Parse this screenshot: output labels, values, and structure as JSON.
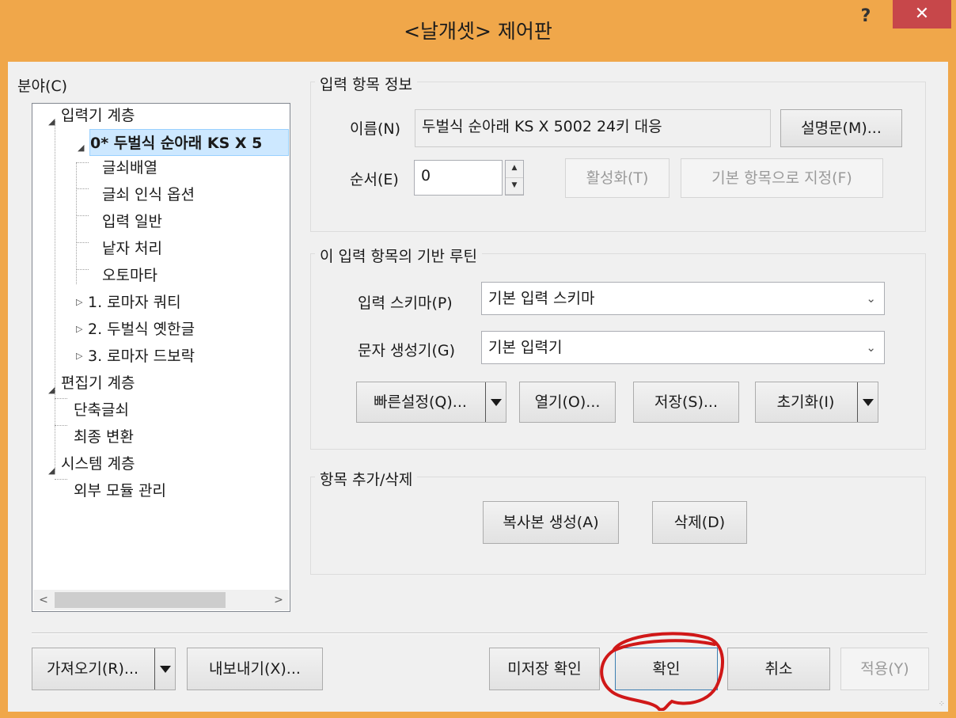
{
  "window": {
    "title": "<날개셋> 제어판",
    "help": "?",
    "close": "✕"
  },
  "colors": {
    "titlebar": "#f0a74a",
    "close": "#c7474a",
    "selection": "#cde8ff",
    "annotation": "#d01818"
  },
  "left": {
    "section_label": "분야(C)",
    "tree": [
      {
        "label": "입력기 계층",
        "level": 0,
        "expanded": true
      },
      {
        "label": "0* 두벌식 순아래 KS X 5",
        "level": 1,
        "expanded": true,
        "selected": true
      },
      {
        "label": "글쇠배열",
        "level": 2
      },
      {
        "label": "글쇠 인식 옵션",
        "level": 2
      },
      {
        "label": "입력 일반",
        "level": 2
      },
      {
        "label": "낱자 처리",
        "level": 2
      },
      {
        "label": "오토마타",
        "level": 2
      },
      {
        "label": "1. 로마자 쿼티",
        "level": 1,
        "expanded": false
      },
      {
        "label": "2. 두벌식 옛한글",
        "level": 1,
        "expanded": false
      },
      {
        "label": "3. 로마자 드보락",
        "level": 1,
        "expanded": false
      },
      {
        "label": "편집기 계층",
        "level": 0,
        "expanded": true
      },
      {
        "label": "단축글쇠",
        "level": 1
      },
      {
        "label": "최종 변환",
        "level": 1
      },
      {
        "label": "시스템 계층",
        "level": 0,
        "expanded": true
      },
      {
        "label": "외부 모듈 관리",
        "level": 1
      }
    ],
    "scroll_left": "<",
    "scroll_right": ">"
  },
  "info": {
    "group_title": "입력 항목 정보",
    "name_label": "이름(N)",
    "name_value": "두벌식 순아래 KS X 5002 24키 대응",
    "desc_button": "설명문(M)...",
    "order_label": "순서(E)",
    "order_value": "0",
    "activate_button": "활성화(T)",
    "default_button": "기본 항목으로 지정(F)"
  },
  "routine": {
    "group_title": "이 입력 항목의 기반 루틴",
    "schema_label": "입력 스키마(P)",
    "schema_value": "기본 입력 스키마",
    "generator_label": "문자 생성기(G)",
    "generator_value": "기본 입력기",
    "quick_button": "빠른설정(Q)...",
    "open_button": "열기(O)...",
    "save_button": "저장(S)...",
    "reset_button": "초기화(I)"
  },
  "items": {
    "group_title": "항목 추가/삭제",
    "copy_button": "복사본 생성(A)",
    "delete_button": "삭제(D)"
  },
  "footer": {
    "import_button": "가져오기(R)...",
    "export_button": "내보내기(X)...",
    "unsaved_button": "미저장 확인",
    "ok_button": "확인",
    "cancel_button": "취소",
    "apply_button": "적용(Y)"
  }
}
